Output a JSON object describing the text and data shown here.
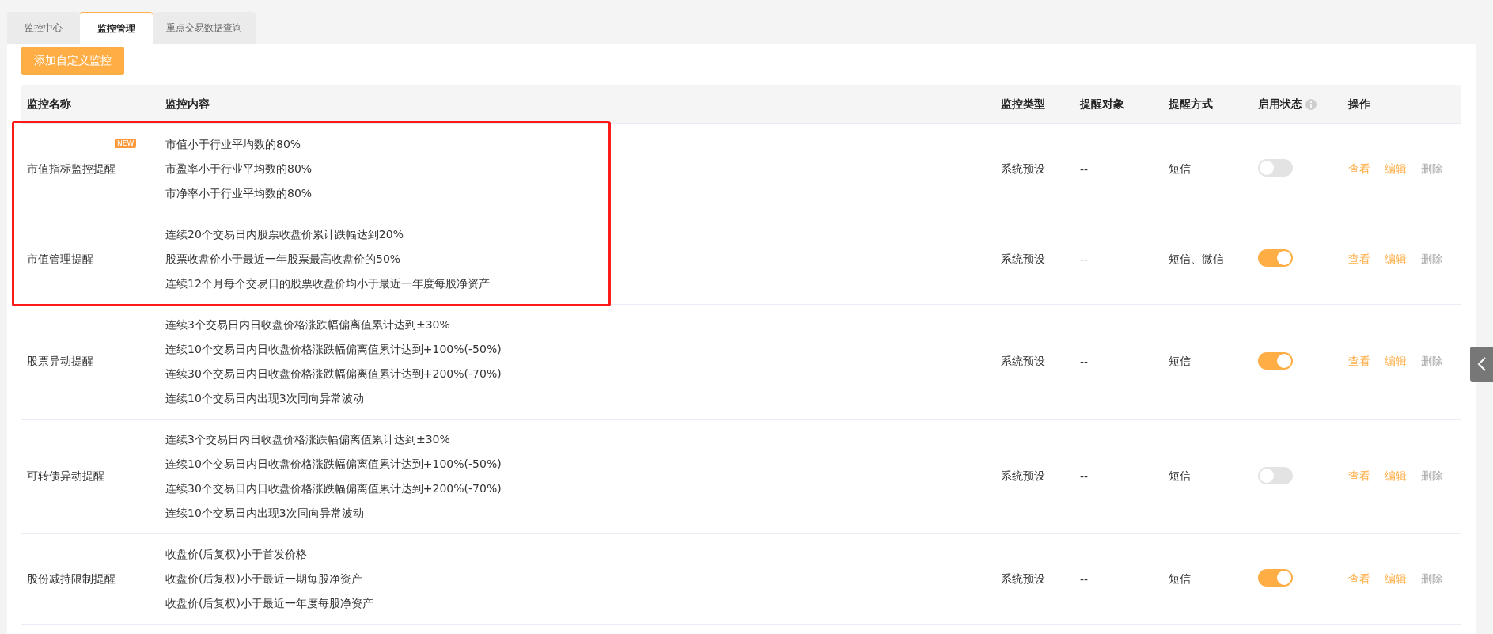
{
  "tabs": [
    {
      "label": "监控中心",
      "selected": false
    },
    {
      "label": "监控管理",
      "selected": true
    },
    {
      "label": "重点交易数据查询",
      "selected": false
    }
  ],
  "add_button": "添加自定义监控",
  "table": {
    "columns": [
      "监控名称",
      "监控内容",
      "监控类型",
      "提醒对象",
      "提醒方式",
      "启用状态",
      "操作"
    ],
    "rows": [
      {
        "name": "市值指标监控提醒",
        "badge": "NEW",
        "contents": [
          "市值小于行业平均数的80%",
          "市盈率小于行业平均数的80%",
          "市净率小于行业平均数的80%"
        ],
        "type": "系统预设",
        "target": "--",
        "method": "短信",
        "enabled": false,
        "actions": [
          {
            "label": "查看",
            "disabled": false
          },
          {
            "label": "编辑",
            "disabled": false
          },
          {
            "label": "删除",
            "disabled": true
          }
        ]
      },
      {
        "name": "市值管理提醒",
        "contents": [
          "连续20个交易日内股票收盘价累计跌幅达到20%",
          "股票收盘价小于最近一年股票最高收盘价的50%",
          "连续12个月每个交易日的股票收盘价均小于最近一年度每股净资产"
        ],
        "type": "系统预设",
        "target": "--",
        "method": "短信、微信",
        "enabled": true,
        "actions": [
          {
            "label": "查看",
            "disabled": false
          },
          {
            "label": "编辑",
            "disabled": false
          },
          {
            "label": "删除",
            "disabled": true
          }
        ]
      },
      {
        "name": "股票异动提醒",
        "contents": [
          "连续3个交易日内日收盘价格涨跌幅偏离值累计达到±30%",
          "连续10个交易日内日收盘价格涨跌幅偏离值累计达到+100%(-50%)",
          "连续30个交易日内日收盘价格涨跌幅偏离值累计达到+200%(-70%)",
          "连续10个交易日内出现3次同向异常波动"
        ],
        "type": "系统预设",
        "target": "--",
        "method": "短信",
        "enabled": true,
        "actions": [
          {
            "label": "查看",
            "disabled": false
          },
          {
            "label": "编辑",
            "disabled": false
          },
          {
            "label": "删除",
            "disabled": true
          }
        ]
      },
      {
        "name": "可转债异动提醒",
        "contents": [
          "连续3个交易日内日收盘价格涨跌幅偏离值累计达到±30%",
          "连续10个交易日内日收盘价格涨跌幅偏离值累计达到+100%(-50%)",
          "连续30个交易日内日收盘价格涨跌幅偏离值累计达到+200%(-70%)",
          "连续10个交易日内出现3次同向异常波动"
        ],
        "type": "系统预设",
        "target": "--",
        "method": "短信",
        "enabled": false,
        "actions": [
          {
            "label": "查看",
            "disabled": false
          },
          {
            "label": "编辑",
            "disabled": false
          },
          {
            "label": "删除",
            "disabled": true
          }
        ]
      },
      {
        "name": "股份减持限制提醒",
        "contents": [
          "收盘价(后复权)小于首发价格",
          "收盘价(后复权)小于最近一期每股净资产",
          "收盘价(后复权)小于最近一年度每股净资产"
        ],
        "type": "系统预设",
        "target": "--",
        "method": "短信",
        "enabled": true,
        "actions": [
          {
            "label": "查看",
            "disabled": false
          },
          {
            "label": "编辑",
            "disabled": false
          },
          {
            "label": "删除",
            "disabled": true
          }
        ]
      }
    ]
  }
}
